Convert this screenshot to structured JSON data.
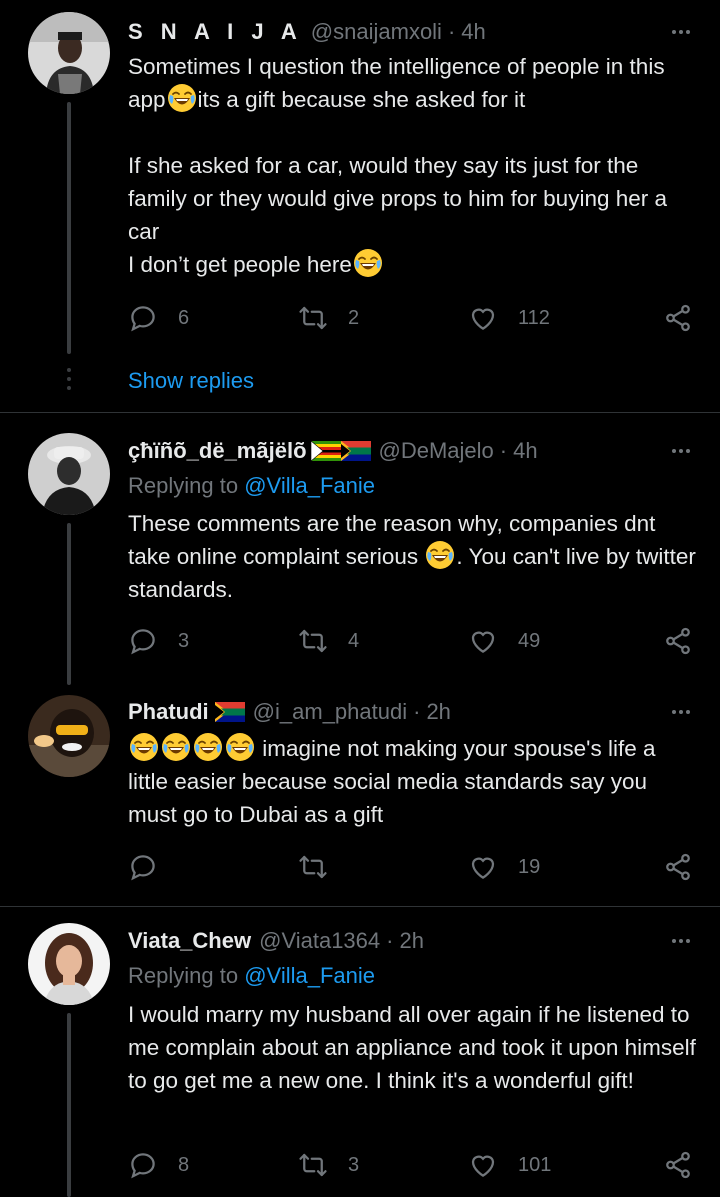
{
  "tweets": [
    {
      "name": "S N A I J A",
      "handle": "@snaijamxoli",
      "separator": "·",
      "time": "4h",
      "body": [
        "Sometimes I question the intelligence of people in this app{laugh}its a gift because she asked for it",
        "",
        "If she asked for a car, would they say its just for the family or they would give props to him for buying her a car",
        "I don’t get people here{laugh}"
      ],
      "replies": "6",
      "retweets": "2",
      "likes": "112",
      "show_replies": "Show replies"
    },
    {
      "name": "çħïñõ_dë_mãjëlõ",
      "flags": [
        "zimbabwe-flag",
        "south-africa-flag"
      ],
      "handle": "@DeMajelo",
      "separator": "·",
      "time": "4h",
      "replying_prefix": "Replying to",
      "replying_to": "@Villa_Fanie",
      "body": [
        "These comments are the reason why, companies dnt take online complaint serious {laugh}. You can't live by twitter standards."
      ],
      "replies": "3",
      "retweets": "4",
      "likes": "49"
    },
    {
      "name": "Phatudi",
      "flags": [
        "south-africa-flag"
      ],
      "handle": "@i_am_phatudi",
      "separator": "·",
      "time": "2h",
      "body": [
        "{laugh}{laugh}{laugh}{laugh} imagine not making your spouse's life a little easier because social media standards say you must go to Dubai as a gift"
      ],
      "replies": "",
      "retweets": "",
      "likes": "19"
    },
    {
      "name": "Viata_Chew",
      "handle": "@Viata1364",
      "separator": "·",
      "time": "2h",
      "replying_prefix": "Replying to",
      "replying_to": "@Villa_Fanie",
      "body": [
        "I would marry my husband all over again if he listened to me complain about an appliance and took it upon himself to go get me a new one. I think it's a wonderful gift!"
      ],
      "replies": "8",
      "retweets": "3",
      "likes": "101"
    }
  ],
  "colors": {
    "background": "#000000",
    "text": "#e7e9ea",
    "muted": "#71767b",
    "link": "#1d9bf0",
    "divider": "#2f3336"
  }
}
